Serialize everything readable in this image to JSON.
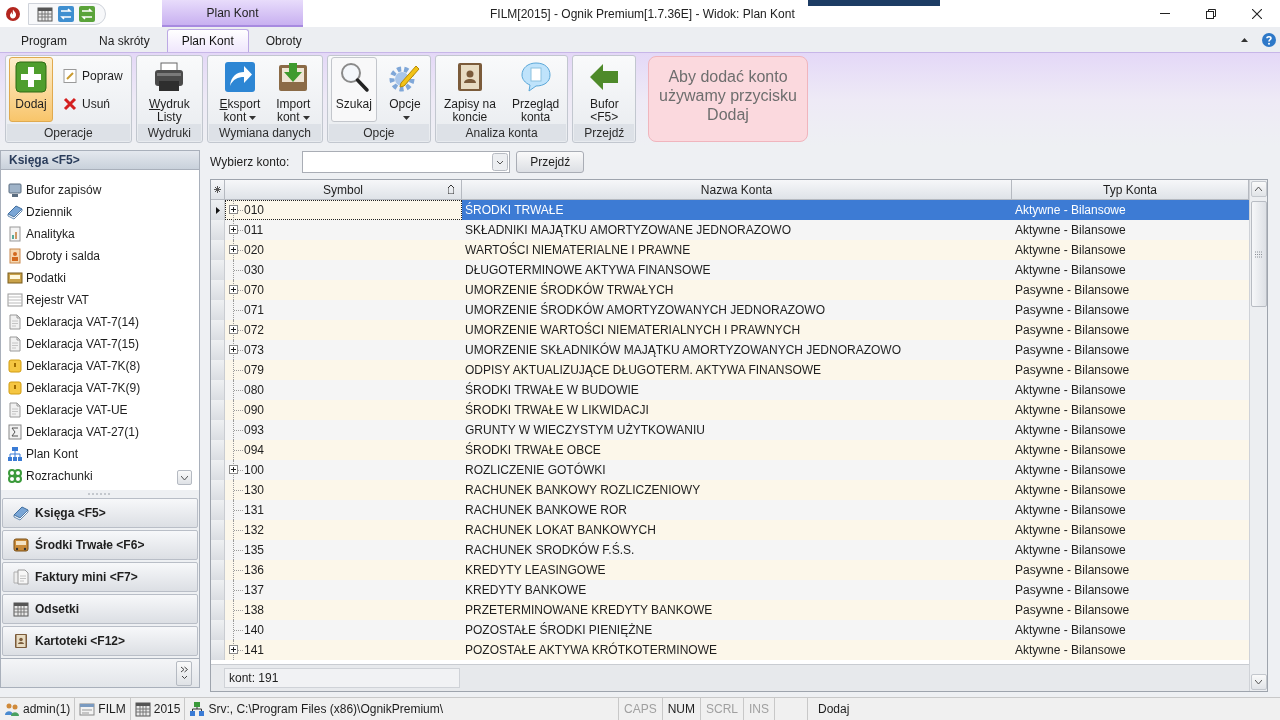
{
  "title_bar": {
    "context_group": "Plan Kont",
    "title": "FILM[2015] - Ognik Premium[1.7.36E] - Widok: Plan Kont"
  },
  "ribbon_tabs": [
    {
      "label": "Program",
      "selected": false
    },
    {
      "label": "Na skróty",
      "selected": false
    },
    {
      "label": "Plan Kont",
      "selected": true
    },
    {
      "label": "Obroty",
      "selected": false
    }
  ],
  "ribbon_groups": [
    {
      "title": "Operacje",
      "buttons": [
        {
          "kind": "large",
          "lines": [
            "Dodaj"
          ],
          "highlighted": true,
          "pressed": false,
          "dropdown": false,
          "underline_first": false
        },
        {
          "kind": "small",
          "lines": [
            "Popraw"
          ],
          "highlighted": false,
          "pressed": false,
          "dropdown": false,
          "underline_first": false
        },
        {
          "kind": "small",
          "lines": [
            "Usuń"
          ],
          "highlighted": false,
          "pressed": false,
          "dropdown": false,
          "underline_first": false
        }
      ]
    },
    {
      "title": "Wydruki",
      "buttons": [
        {
          "kind": "large",
          "lines": [
            "Wydruk",
            "Listy"
          ],
          "highlighted": false,
          "pressed": false,
          "dropdown": false,
          "underline_first": true
        }
      ]
    },
    {
      "title": "Wymiana danych",
      "buttons": [
        {
          "kind": "large",
          "lines": [
            "Eksport",
            "kont"
          ],
          "highlighted": false,
          "pressed": false,
          "dropdown": true,
          "underline_first": true
        },
        {
          "kind": "large",
          "lines": [
            "Import",
            "kont"
          ],
          "highlighted": false,
          "pressed": false,
          "dropdown": true,
          "underline_first": false
        }
      ]
    },
    {
      "title": "Opcje",
      "buttons": [
        {
          "kind": "large",
          "lines": [
            "Szukaj"
          ],
          "highlighted": false,
          "pressed": true,
          "dropdown": false,
          "underline_first": false
        },
        {
          "kind": "large",
          "lines": [
            "Opcje"
          ],
          "highlighted": false,
          "pressed": false,
          "dropdown": true,
          "underline_first": false
        }
      ]
    },
    {
      "title": "Analiza konta",
      "buttons": [
        {
          "kind": "large",
          "lines": [
            "Zapisy na",
            "koncie"
          ],
          "highlighted": false,
          "pressed": false,
          "dropdown": false,
          "underline_first": false
        },
        {
          "kind": "large",
          "lines": [
            "Przegląd",
            "konta"
          ],
          "highlighted": false,
          "pressed": false,
          "dropdown": false,
          "underline_first": false
        }
      ]
    },
    {
      "title": "Przejdź",
      "buttons": [
        {
          "kind": "large",
          "lines": [
            "Bufor",
            "<F5>"
          ],
          "highlighted": false,
          "pressed": false,
          "dropdown": false,
          "underline_first": false
        }
      ]
    }
  ],
  "tooltip": {
    "text": "Aby dodać konto używamy przycisku Dodaj"
  },
  "sidebar": {
    "header": "Księga <F5>",
    "items": [
      "Bufor zapisów",
      "Dziennik",
      "Analityka",
      "Obroty i salda",
      "Podatki",
      "Rejestr VAT",
      "Deklaracja VAT-7(14)",
      "Deklaracja VAT-7(15)",
      "Deklaracja VAT-7K(8)",
      "Deklaracja VAT-7K(9)",
      "Deklaracje VAT-UE",
      "Deklaracja VAT-27(1)",
      "Plan Kont",
      "Rozrachunki"
    ],
    "nav_buttons": [
      "Księga <F5>",
      "Środki Trwałe <F6>",
      "Faktury mini <F7>",
      "Odsetki",
      "Kartoteki <F12>"
    ]
  },
  "account_picker": {
    "label": "Wybierz konto:",
    "button": "Przejdź"
  },
  "table": {
    "columns": [
      {
        "label": "Symbol",
        "sorted": true
      },
      {
        "label": "Nazwa Konta",
        "sorted": false
      },
      {
        "label": "Typ Konta",
        "sorted": false
      }
    ],
    "rows": [
      {
        "symbol": "010",
        "name": "ŚRODKI TRWAŁE",
        "type": "Aktywne - Bilansowe",
        "selected": true,
        "expandable": true
      },
      {
        "symbol": "011",
        "name": "SKŁADNIKI MAJĄTKU AMORTYZOWANE JEDNORAZOWO",
        "type": "Aktywne - Bilansowe",
        "selected": false,
        "expandable": true
      },
      {
        "symbol": "020",
        "name": "WARTOŚCI NIEMATERIALNE I PRAWNE",
        "type": "Aktywne - Bilansowe",
        "selected": false,
        "expandable": true
      },
      {
        "symbol": "030",
        "name": "DŁUGOTERMINOWE AKTYWA FINANSOWE",
        "type": "Aktywne - Bilansowe",
        "selected": false,
        "expandable": false
      },
      {
        "symbol": "070",
        "name": "UMORZENIE ŚRODKÓW TRWAŁYCH",
        "type": "Pasywne - Bilansowe",
        "selected": false,
        "expandable": true
      },
      {
        "symbol": "071",
        "name": "UMORZENIE ŚRODKÓW AMORTYZOWANYCH JEDNORAZOWO",
        "type": "Pasywne - Bilansowe",
        "selected": false,
        "expandable": false
      },
      {
        "symbol": "072",
        "name": "UMORZENIE WARTOŚCI NIEMATERIALNYCH I PRAWNYCH",
        "type": "Pasywne - Bilansowe",
        "selected": false,
        "expandable": true
      },
      {
        "symbol": "073",
        "name": "UMORZENIE SKŁADNIKÓW MAJĄTKU AMORTYZOWANYCH JEDNORAZOWO",
        "type": "Pasywne - Bilansowe",
        "selected": false,
        "expandable": true
      },
      {
        "symbol": "079",
        "name": "ODPISY AKTUALIZUJĄCE DŁUGOTERM. AKTYWA FINANSOWE",
        "type": "Pasywne - Bilansowe",
        "selected": false,
        "expandable": false
      },
      {
        "symbol": "080",
        "name": "ŚRODKI TRWAŁE W BUDOWIE",
        "type": "Aktywne - Bilansowe",
        "selected": false,
        "expandable": false
      },
      {
        "symbol": "090",
        "name": "ŚRODKI TRWAŁE W LIKWIDACJI",
        "type": "Aktywne - Bilansowe",
        "selected": false,
        "expandable": false
      },
      {
        "symbol": "093",
        "name": "GRUNTY W WIECZYSTYM UŻYTKOWANIU",
        "type": "Aktywne - Bilansowe",
        "selected": false,
        "expandable": false
      },
      {
        "symbol": "094",
        "name": "ŚRODKI TRWAŁE OBCE",
        "type": "Aktywne - Bilansowe",
        "selected": false,
        "expandable": false
      },
      {
        "symbol": "100",
        "name": "ROZLICZENIE GOTÓWKI",
        "type": "Aktywne - Bilansowe",
        "selected": false,
        "expandable": true
      },
      {
        "symbol": "130",
        "name": "RACHUNEK BANKOWY ROZLICZENIOWY",
        "type": "Aktywne - Bilansowe",
        "selected": false,
        "expandable": false
      },
      {
        "symbol": "131",
        "name": "RACHUNEK BANKOWE ROR",
        "type": "Aktywne - Bilansowe",
        "selected": false,
        "expandable": false
      },
      {
        "symbol": "132",
        "name": "RACHUNEK LOKAT BANKOWYCH",
        "type": "Aktywne - Bilansowe",
        "selected": false,
        "expandable": false
      },
      {
        "symbol": "135",
        "name": "RACHUNEK SRODKÓW F.Ś.S.",
        "type": "Aktywne - Bilansowe",
        "selected": false,
        "expandable": false
      },
      {
        "symbol": "136",
        "name": "KREDYTY LEASINGOWE",
        "type": "Pasywne - Bilansowe",
        "selected": false,
        "expandable": false
      },
      {
        "symbol": "137",
        "name": "KREDYTY BANKOWE",
        "type": "Pasywne - Bilansowe",
        "selected": false,
        "expandable": false
      },
      {
        "symbol": "138",
        "name": "PRZETERMINOWANE KREDYTY BANKOWE",
        "type": "Pasywne - Bilansowe",
        "selected": false,
        "expandable": false
      },
      {
        "symbol": "140",
        "name": "POZOSTAŁE ŚRODKI PIENIĘŻNE",
        "type": "Aktywne - Bilansowe",
        "selected": false,
        "expandable": false
      },
      {
        "symbol": "141",
        "name": "POZOSTAŁE AKTYWA KRÓTKOTERMINOWE",
        "type": "Aktywne - Bilansowe",
        "selected": false,
        "expandable": true
      }
    ],
    "footer": "kont: 191"
  },
  "status_bar": {
    "items": [
      "admin(1)",
      "FILM",
      "2015",
      "Srv:, C:\\Program Files (x86)\\OgnikPremium\\"
    ],
    "keys": [
      {
        "label": "CAPS",
        "on": false
      },
      {
        "label": "NUM",
        "on": true
      },
      {
        "label": "SCRL",
        "on": false
      },
      {
        "label": "INS",
        "on": false
      }
    ],
    "message": "Dodaj"
  }
}
